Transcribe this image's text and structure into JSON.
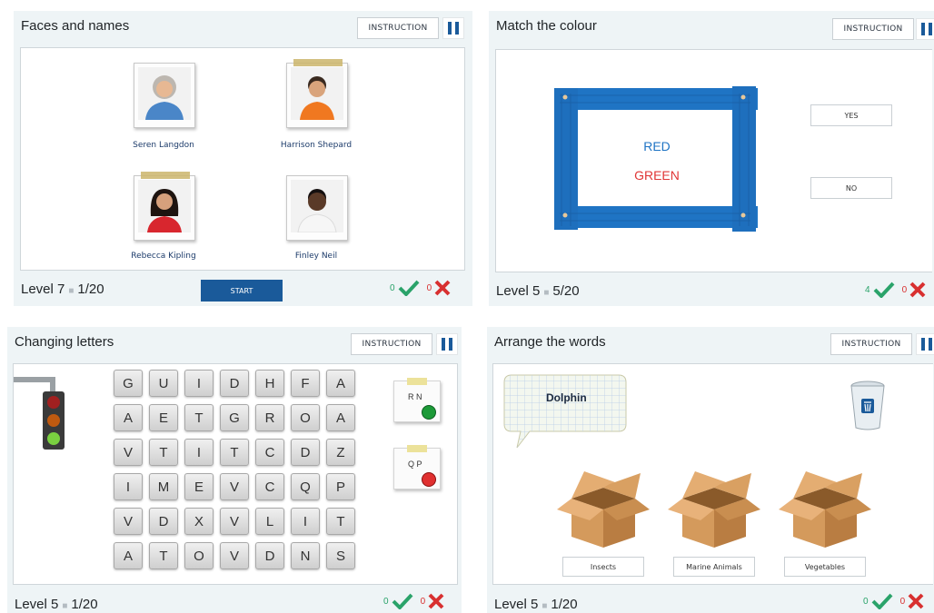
{
  "panel1": {
    "title": "Faces and names",
    "instruction": "INSTRUCTION",
    "people": [
      "Seren Langdon",
      "Harrison Shepard",
      "Rebecca Kipling",
      "Finley Neil"
    ],
    "level": "Level 7",
    "progress": "1/20",
    "start": "START",
    "correct": "0",
    "wrong": "0"
  },
  "panel2": {
    "title": "Match the colour",
    "instruction": "INSTRUCTION",
    "word1": "RED",
    "word2": "GREEN",
    "yes": "YES",
    "no": "NO",
    "level": "Level 5",
    "progress": "5/20",
    "correct": "4",
    "wrong": "0"
  },
  "panel3": {
    "title": "Changing letters",
    "instruction": "INSTRUCTION",
    "grid": [
      [
        "G",
        "U",
        "I",
        "D",
        "H",
        "F",
        "A"
      ],
      [
        "A",
        "E",
        "T",
        "G",
        "R",
        "O",
        "A"
      ],
      [
        "V",
        "T",
        "I",
        "T",
        "C",
        "D",
        "Z"
      ],
      [
        "I",
        "M",
        "E",
        "V",
        "C",
        "Q",
        "P"
      ],
      [
        "V",
        "D",
        "X",
        "V",
        "L",
        "I",
        "T"
      ],
      [
        "A",
        "T",
        "O",
        "V",
        "D",
        "N",
        "S"
      ]
    ],
    "note1": "R N",
    "note2": "Q P",
    "level": "Level 5",
    "progress": "1/20",
    "correct": "0",
    "wrong": "0"
  },
  "panel4": {
    "title": "Arrange the words",
    "instruction": "INSTRUCTION",
    "word": "Dolphin",
    "boxes": [
      "Insects",
      "Marine Animals",
      "Vegetables"
    ],
    "level": "Level 5",
    "progress": "1/20",
    "correct": "0",
    "wrong": "0"
  },
  "colors": {
    "accent": "#1a5a9a",
    "check": "#2aa36a",
    "cross": "#d83030",
    "frame": "#1f74c4"
  }
}
